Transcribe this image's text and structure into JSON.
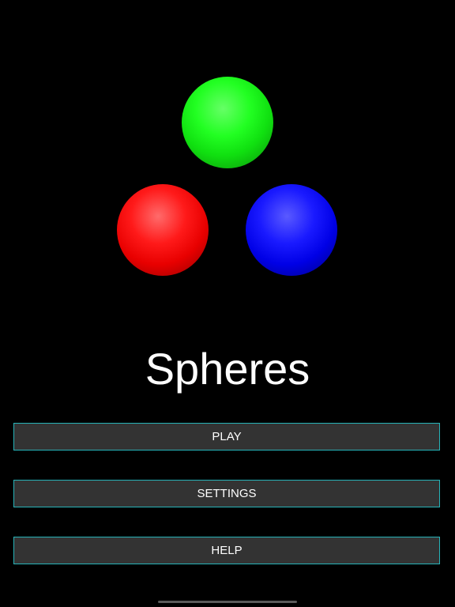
{
  "title": "Spheres",
  "spheres": [
    {
      "name": "green",
      "color": "#1ee01e"
    },
    {
      "name": "red",
      "color": "#ff1a1a"
    },
    {
      "name": "blue",
      "color": "#1a1aff"
    }
  ],
  "menu": {
    "play_label": "PLAY",
    "settings_label": "SETTINGS",
    "help_label": "HELP"
  },
  "colors": {
    "background": "#000000",
    "button_fill": "#333333",
    "button_border": "#27b3b8",
    "text": "#ffffff"
  }
}
